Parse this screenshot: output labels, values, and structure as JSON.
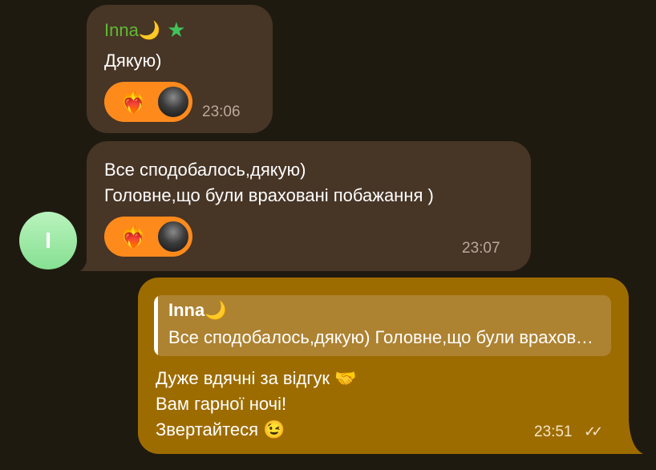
{
  "messages": [
    {
      "sender": "Inna",
      "moon": "🌙",
      "star": "★",
      "text": "Дякую)",
      "reaction": "❤️‍🔥",
      "time": "23:06"
    },
    {
      "lines": [
        "Все сподобалось,дякую)",
        "Головне,що були враховані побажання )"
      ],
      "reaction": "❤️‍🔥",
      "time": "23:07",
      "avatar_letter": "I"
    },
    {
      "reply_to": {
        "name": "Inna",
        "moon": "🌙",
        "text": "Все сподобалось,дякую) Головне,що були враховані побажання )"
      },
      "lines": [
        "Дуже вдячні за відгук 🤝",
        "Вам гарної ночі!",
        "Звертайтеся 😉"
      ],
      "time": "23:51",
      "status": "✓✓"
    }
  ],
  "colors": {
    "background": "#1f1a10",
    "incoming_bubble": "#473526",
    "outgoing_bubble": "#9d6c00",
    "sender_name": "#5fba33",
    "reaction_pill": "#ff8a1c"
  }
}
